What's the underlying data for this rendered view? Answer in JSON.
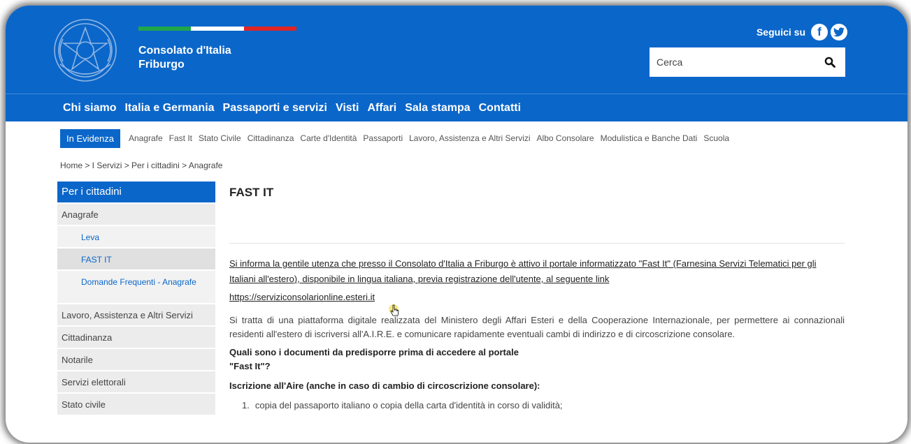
{
  "header": {
    "brand_name": "Consolato d'Italia",
    "brand_city": "Friburgo",
    "social_label": "Seguici su",
    "facebook_icon": "f",
    "twitter_icon": "t",
    "search_placeholder": "Cerca",
    "colors": {
      "primary": "#0b66c9",
      "flag_green": "#1fa64a",
      "flag_white": "#ffffff",
      "flag_red": "#e02424"
    }
  },
  "mainnav": {
    "items": [
      "Chi siamo",
      "Italia e Germania",
      "Passaporti e servizi",
      "Visti",
      "Affari",
      "Sala stampa",
      "Contatti"
    ]
  },
  "subnav": {
    "active": "In Evidenza",
    "items": [
      "Anagrafe",
      "Fast It",
      "Stato Civile",
      "Cittadinanza",
      "Carte d'Identità",
      "Passaporti",
      "Lavoro, Assistenza e Altri Servizi",
      "Albo Consolare",
      "Modulistica e Banche Dati",
      "Scuola"
    ]
  },
  "breadcrumb": "Home > I Servizi > Per i cittadini > Anagrafe",
  "sidebar": {
    "title": "Per i cittadini",
    "items": [
      {
        "label": "Anagrafe"
      },
      {
        "label": "Leva"
      },
      {
        "label": "FAST IT"
      },
      {
        "label": "Domande Frequenti - Anagrafe"
      },
      {
        "label": "Lavoro, Assistenza e Altri Servizi"
      },
      {
        "label": "Cittadinanza"
      },
      {
        "label": "Notarile"
      },
      {
        "label": "Servizi elettorali"
      },
      {
        "label": "Stato civile"
      }
    ]
  },
  "content": {
    "title": "FAST IT",
    "intro": "Si informa la gentile utenza che presso il Consolato d'Italia a Friburgo è attivo il portale informatizzato \"Fast It\" (Farnesina Servizi Telematici per gli Italiani all'estero), disponibile in lingua italiana, previa registrazione dell'utente, al seguente link",
    "link": "https://serviziconsolarionline.esteri.it",
    "description": "Si tratta di una piattaforma digitale realizzata del Ministero degli Affari Esteri e della Cooperazione Internazionale, per permettere ai connazionali residenti all'estero di iscriversi all'A.I.R.E. e comunicare rapidamente eventuali cambi di indirizzo e di circoscrizione consolare.",
    "question": "Quali sono i documenti da predisporre prima di accedere al portale \"Fast It\"?",
    "section_heading": "Iscrizione all'Aire (anche in caso di cambio di circoscrizione consolare):",
    "list": [
      {
        "num": "1.",
        "text": "copia del passaporto italiano o copia della carta d'identità in corso di validità;"
      }
    ]
  }
}
